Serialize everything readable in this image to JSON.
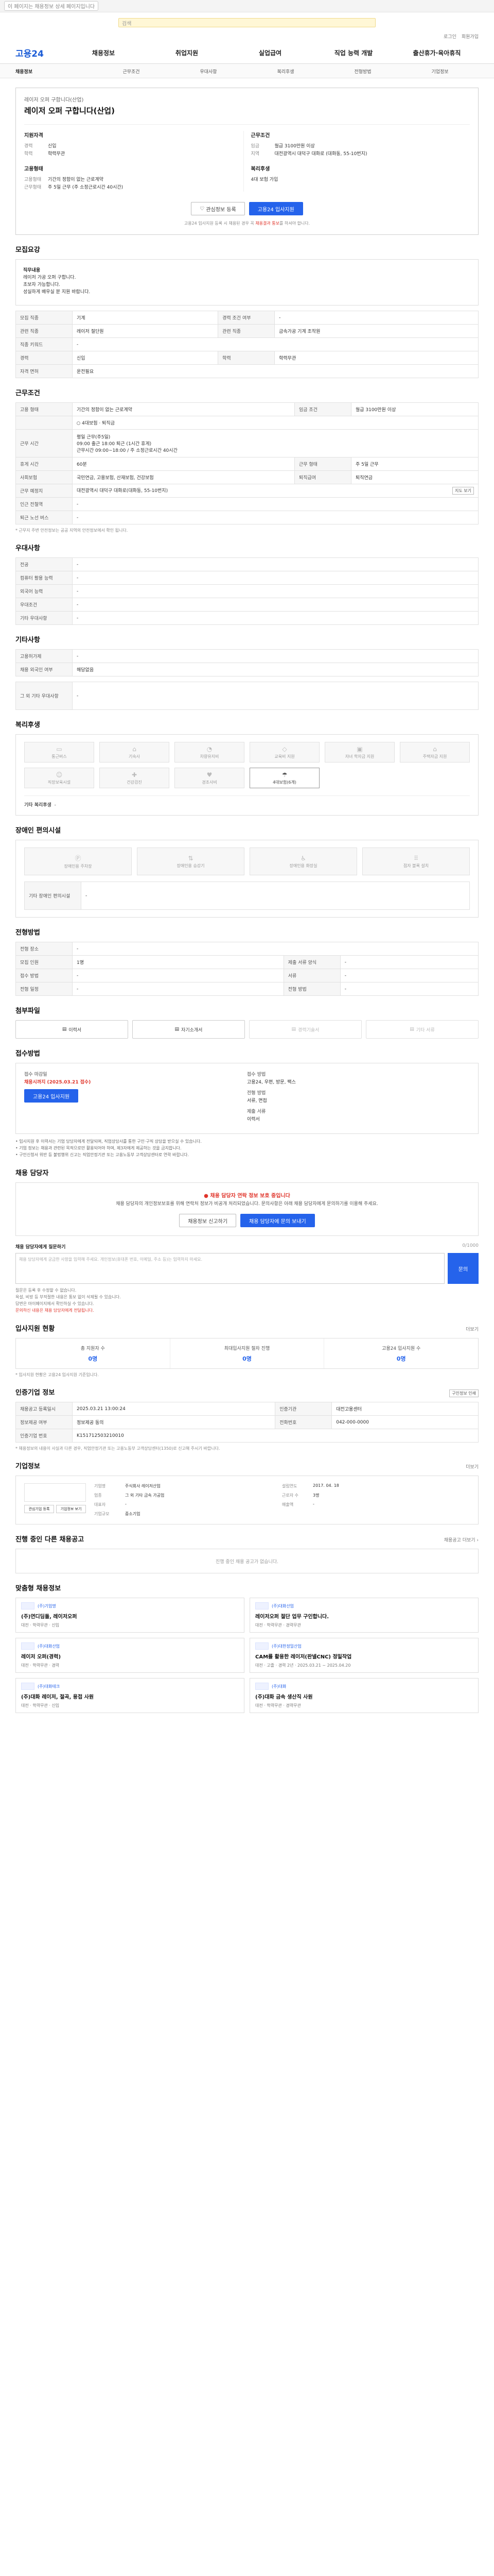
{
  "topbar": {
    "notice": "이 페이지는 채용정보 상세 페이지입니다"
  },
  "search": {
    "placeholder": "검색"
  },
  "util": [
    "로그인",
    "회원가입"
  ],
  "brand": {
    "logo": "고용24"
  },
  "gnb": [
    "채용정보",
    "취업지원",
    "실업급여",
    "직업 능력 개발",
    "출산휴가·육아휴직"
  ],
  "subnav": [
    "채용정보",
    "근무조건",
    "우대사항",
    "복리후생",
    "전형방법",
    "기업정보"
  ],
  "job": {
    "company": "레이저 오퍼 구합니다(산업)",
    "title": "레이저 오퍼 구합니다(산업)",
    "left_title": "지원자격",
    "left": [
      {
        "k": "경력",
        "v": "신입"
      },
      {
        "k": "학력",
        "v": "학력무관"
      }
    ],
    "left_title2": "고용형태",
    "left2": [
      {
        "k": "고용형태",
        "v": "기간의 정함이 없는 근로계약"
      },
      {
        "k": "근무형태",
        "v": "주 5일 근무 (주 소정근로시간 40시간)"
      }
    ],
    "right_title": "근무조건",
    "right": [
      {
        "k": "임금",
        "v": "월급 3100만원 이상"
      },
      {
        "k": "지역",
        "v": "대전광역시 대덕구 대화로 (대화동, 55-10번지)"
      }
    ],
    "right_title2": "복리후생",
    "right2": [
      {
        "k": "",
        "v": "4대 보험 가입"
      }
    ],
    "btn_save": "관심정보 등록",
    "btn_apply": "고용24 입사지원",
    "note": "고용24 입사지원 등록 시 채용된 경우 꼭 ",
    "note_red": "채용결과 통보",
    "note_tail": "를 하셔야 합니다."
  },
  "recruit": {
    "title": "모집요강",
    "desc_label": "직무내용",
    "desc_lines": [
      "레이저 가공 오퍼 구합니다.",
      "초보자 가능합니다.",
      "성실하게 배우실 분 지원 바랍니다."
    ],
    "rows": [
      [
        "모집 직종",
        "기계",
        "경력 조건 여부",
        "-"
      ],
      [
        "관련 직종",
        "레이저 절단원",
        "관련 직종",
        "금속가공 기계 조작원"
      ],
      [
        "직종 키워드",
        "-",
        "",
        ""
      ],
      [
        "경력",
        "신입",
        "학력",
        "학력무관"
      ],
      [
        "자격 면허",
        "운전필요",
        "",
        ""
      ]
    ]
  },
  "cond": {
    "title": "근무조건",
    "rows": [
      [
        "고용 형태",
        "기간의 정함이 없는 근로계약",
        "임금 조건",
        "월급 3100만원 이상"
      ],
      [
        "",
        "4대보험  · 퇴직금",
        "",
        ""
      ]
    ],
    "work_label": "근무 시간",
    "work_lines": [
      "평일 근무(주5일)",
      "09:00 출근 18:00 퇴근 (1시간 휴게)",
      "근무시간 09:00~18:00 / 주 소정근로시간 40시간"
    ],
    "rows2": [
      [
        "휴게 시간",
        "60분",
        "근무 형태",
        "주 5일 근무"
      ],
      [
        "사회보험",
        "국민연금, 고용보험, 산재보험, 건강보험",
        "퇴직급여",
        "퇴직연금"
      ],
      [
        "근무 예정지",
        "대전광역시 대덕구 대화로(대화동, 55-10번지)",
        "",
        ""
      ],
      [
        "인근 전철역",
        "-",
        "",
        ""
      ],
      [
        "퇴근 노선 버스",
        "-",
        "",
        ""
      ]
    ],
    "map_btn": "지도 보기",
    "footnote": "* 근무지 주변 안전정보는 공공 지역의 안전정보에서 확인 됩니다."
  },
  "pref": {
    "title": "우대사항",
    "rows": [
      [
        "전공",
        "-"
      ],
      [
        "컴퓨터 활용 능력",
        "-"
      ],
      [
        "외국어 능력",
        "-"
      ],
      [
        "우대조건",
        "-"
      ],
      [
        "기타 우대사항",
        "-"
      ]
    ]
  },
  "etc": {
    "title": "기타사항",
    "rows": [
      [
        "고용허가제",
        "-"
      ],
      [
        "채용 외국인 여부",
        "해당없음"
      ]
    ],
    "rows2": [
      [
        "그 외 기타 우대사항",
        "-"
      ]
    ]
  },
  "welfare": {
    "title": "복리후생",
    "items": [
      {
        "icon": "bus-icon",
        "label": "통근버스",
        "active": false
      },
      {
        "icon": "dorm-icon",
        "label": "기숙사",
        "active": false
      },
      {
        "icon": "meal-icon",
        "label": "차량유지비",
        "active": false
      },
      {
        "icon": "car-icon",
        "label": "교육비 지원",
        "active": false
      },
      {
        "icon": "gift-icon",
        "label": "자녀 학자금 지원",
        "active": false
      },
      {
        "icon": "house-icon",
        "label": "주택자금 지원",
        "active": false
      },
      {
        "icon": "child-icon",
        "label": "직장보육시설",
        "active": false
      },
      {
        "icon": "health-icon",
        "label": "건강검진",
        "active": false
      },
      {
        "icon": "family-icon",
        "label": "경조사비",
        "active": false
      },
      {
        "icon": "insurance-icon",
        "label": "4대보험(6개)",
        "active": true
      }
    ],
    "other_label": "기타 복리후생",
    "other_value": "-"
  },
  "access": {
    "title": "장애인 편의시설",
    "items": [
      "장애인용 주차장",
      "장애인용 승강기",
      "장애인용 화장실",
      "점자 블록 설치"
    ],
    "rows": [
      [
        "기타 장애인 편의시설",
        "-"
      ]
    ]
  },
  "procedure": {
    "title": "전형방법",
    "rows": [
      [
        "전형 장소",
        "-"
      ],
      [
        "모집 인원",
        "1명",
        "제출 서류 양식",
        "-"
      ],
      [
        "접수 방법",
        "-",
        "서류",
        "-"
      ],
      [
        "전형 일정",
        "-",
        "전형 방법",
        "-"
      ]
    ]
  },
  "files": {
    "title": "첨부파일",
    "items": [
      {
        "label": "이력서",
        "dim": false
      },
      {
        "label": "자기소개서",
        "dim": false
      },
      {
        "label": "경력기술서",
        "dim": true
      },
      {
        "label": "기타 서류",
        "dim": true
      }
    ]
  },
  "apply": {
    "title": "접수방법",
    "k1": "접수 마감일",
    "v1": "채용시까지 (2025.03.21 접수)",
    "k2": "접수 방법",
    "v2": "고용24, 우편, 방문, 팩스",
    "btn": "고용24 입사지원",
    "k3": "전형 방법",
    "v3": "서류, 면접",
    "k4": "제출 서류",
    "v4": "이력서",
    "bullets": [
      "입사지원 후 이력서는 기업 담당자에게 전달되며, 직업상담사를 통한 구인·구직 상담을 받으실 수 있습니다.",
      "기업 정보는 채용과 관련된 목적으로만 활용되어야 하며, 제3자에게 제공하는 것을 금지합니다.",
      "구인신청서 위반 등 불법행위 신고는 직업안정기관 또는 고용노동부 고객상담센터로 연락 바랍니다."
    ]
  },
  "contact": {
    "title": "채용 담당자",
    "alert_title": "채용 담당자 연락 정보 보호 중입니다",
    "alert_text": "채용 담당자의 개인정보보호를 위해 연락처 정보가 비공개 처리되었습니다. 문의사항은 아래 채용 담당자에게 문의하기를 이용해 주세요.",
    "btn1": "채용정보 신고하기",
    "btn2": "채용 담당자에 문의 보내기",
    "ask_label": "채용 담당자에게 질문하기",
    "ask_count": "0/1000",
    "ask_placeholder": "채용 담당자에게 궁금한 사항을 입력해 주세요. 개인정보(휴대폰 번호, 이메일, 주소 등)는 입력하지 마세요.",
    "ask_btn": "문의",
    "notes": [
      "질문은 등록 후 수정할 수 없습니다.",
      "욕설, 비방 등 부적절한 내용은 통보 없이 삭제될 수 있습니다.",
      "답변은 마이페이지에서 확인하실 수 있습니다."
    ],
    "notes_red": "문의하신 내용은 채용 담당자에게 전달됩니다."
  },
  "status": {
    "title": "입사지원 현황",
    "more": "더보기",
    "items": [
      {
        "t": "총 지원자 수",
        "n": "0명"
      },
      {
        "t": "최대입사지원 절차 진행",
        "n": "0명"
      },
      {
        "t": "고용24 입사지원 수",
        "n": "0명"
      }
    ],
    "note": "* 입사지원 현황은 고용24 입사지원 기준입니다."
  },
  "info": {
    "title": "인증기업 정보",
    "print_btn": "구인정보 인쇄",
    "rows": [
      [
        "채용공고 등록일시",
        "2025.03.21 13:00:24",
        "인증기관",
        "대전고용센터"
      ],
      [
        "정보제공 여부",
        "정보제공 동의",
        "전화번호",
        "042-000-0000"
      ],
      [
        "인증기업 번호",
        "K151712503210010",
        "",
        ""
      ]
    ],
    "footnote": "* 채용정보의 내용이 사실과 다른 경우, 직업안정기관 또는 고용노동부 고객상담센터(1350)로 신고해 주시기 바랍니다."
  },
  "company": {
    "title": "기업정보",
    "more": "더보기",
    "btn1": "관심기업 등록",
    "btn2": "기업정보 보기",
    "fields": [
      [
        "기업명",
        "주식회사 레이저산업",
        "설립연도",
        "2017. 04. 18"
      ],
      [
        "업종",
        "그 외 기타 금속 가공업",
        "근로자 수",
        "3명"
      ],
      [
        "대표자",
        "-",
        "매출액",
        "-"
      ],
      [
        "기업규모",
        "중소기업",
        "",
        ""
      ]
    ]
  },
  "other_jobs": {
    "title": "진행 중인 다른 채용공고",
    "note": "진행 중인 채용 공고가 없습니다.",
    "more": "채용공고 더보기 ›"
  },
  "recommend": {
    "title": "맞춤형 채용정보",
    "items": [
      {
        "co": "(주)기업명",
        "tt": "(주)연디딤돌, 레이저오퍼",
        "meta": "대전 · 학력무관 · 신입"
      },
      {
        "co": "(주)대화산업",
        "tt": "레이저오퍼 절단 업무 구인합니다.",
        "meta": "대전 · 학력무관 · 경력무관"
      },
      {
        "co": "(주)대화산업",
        "tt": "레이저 오퍼(경력)",
        "meta": "대전 · 학력무관 · 경력"
      },
      {
        "co": "(주)대한정밀산업",
        "tt": "CAM를 활용한 레이저(판넬CNC) 정밀작업",
        "meta": "대전 · 고졸 · 경력 2년 · 2025.03.21 ~ 2025.04.20"
      },
      {
        "co": "(주)대화테크",
        "tt": "(주)대화 레이저, 절곡, 용접 사원",
        "meta": "대전 · 학력무관 · 신입"
      },
      {
        "co": "(주)대화",
        "tt": "(주)대화 금속 생산직 사원",
        "meta": "대전 · 학력무관 · 경력무관"
      }
    ]
  }
}
